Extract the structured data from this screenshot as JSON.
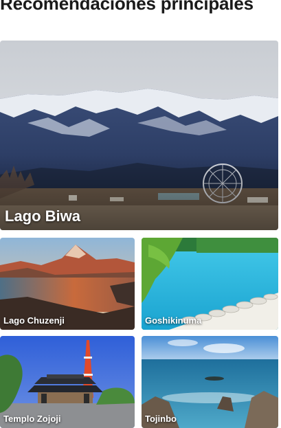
{
  "section": {
    "title": "Recomendaciones principales"
  },
  "cards": [
    {
      "label": "Lago Biwa"
    },
    {
      "label": "Lago Chuzenji"
    },
    {
      "label": "Goshikinuma"
    },
    {
      "label": "Templo Zojoji"
    },
    {
      "label": "Tojinbo"
    }
  ]
}
